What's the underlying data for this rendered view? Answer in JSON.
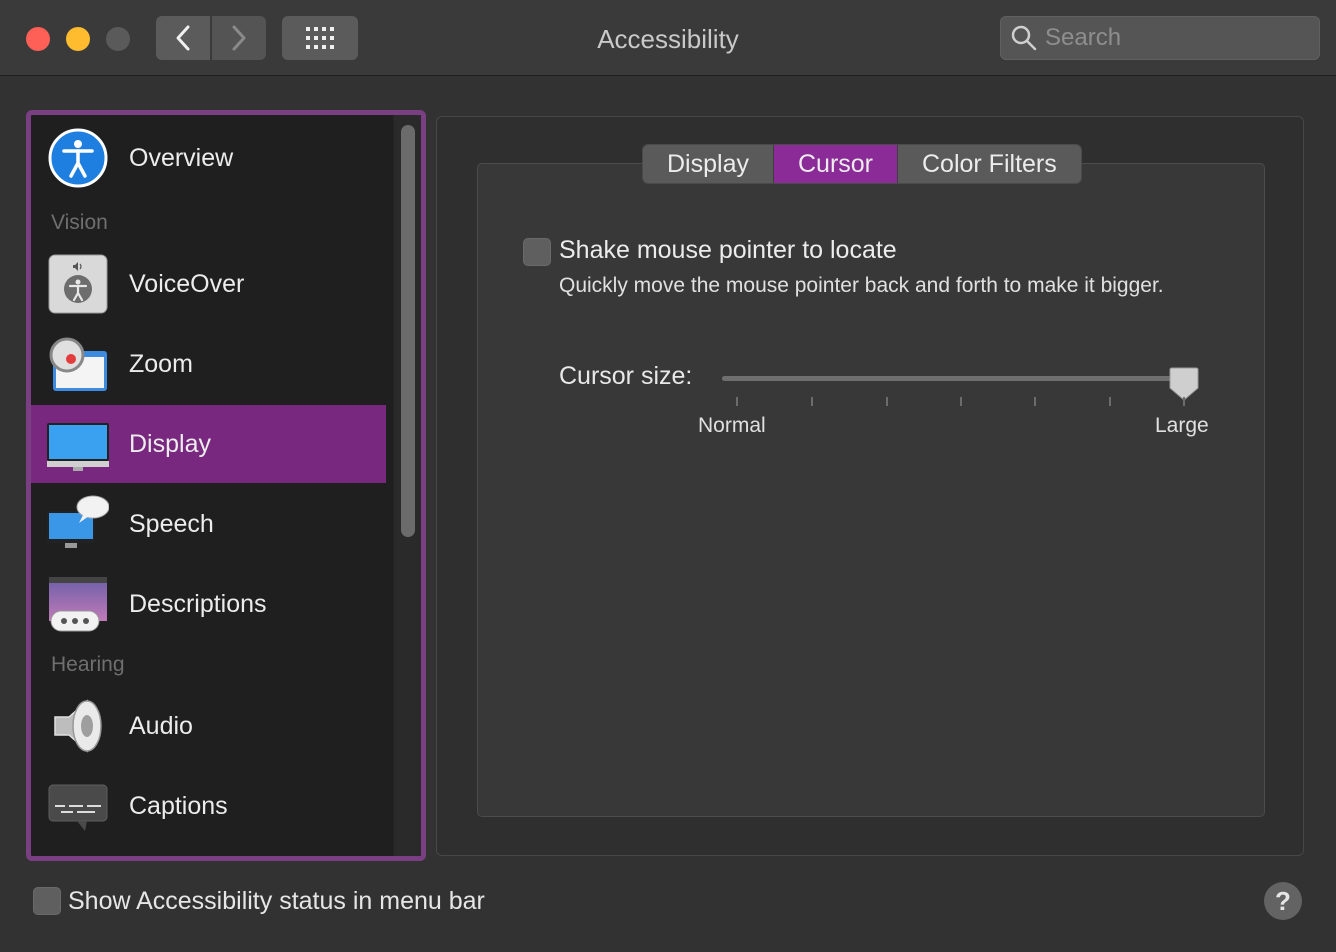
{
  "window": {
    "title": "Accessibility"
  },
  "toolbar": {
    "back_icon": "chevron-left-icon",
    "forward_icon": "chevron-right-icon",
    "grid_icon": "grid-icon"
  },
  "search": {
    "placeholder": "Search",
    "value": ""
  },
  "sidebar": {
    "items": [
      {
        "label": "Overview",
        "icon": "accessibility-overview-icon"
      },
      {
        "label": "VoiceOver",
        "icon": "voiceover-icon"
      },
      {
        "label": "Zoom",
        "icon": "zoom-icon"
      },
      {
        "label": "Display",
        "icon": "display-icon",
        "selected": true
      },
      {
        "label": "Speech",
        "icon": "speech-icon"
      },
      {
        "label": "Descriptions",
        "icon": "descriptions-icon"
      },
      {
        "label": "Audio",
        "icon": "audio-icon"
      },
      {
        "label": "Captions",
        "icon": "captions-icon"
      }
    ],
    "sections": {
      "vision": "Vision",
      "hearing": "Hearing"
    }
  },
  "tabs": [
    {
      "label": "Display"
    },
    {
      "label": "Cursor",
      "active": true
    },
    {
      "label": "Color Filters"
    }
  ],
  "cursor": {
    "shake_label": "Shake mouse pointer to locate",
    "shake_checked": false,
    "shake_description": "Quickly move the mouse pointer back and forth to make it bigger.",
    "size_label": "Cursor size:",
    "size_min_label": "Normal",
    "size_max_label": "Large",
    "size_value_fraction": 1.0
  },
  "footer": {
    "status_label": "Show Accessibility status in menu bar",
    "status_checked": false,
    "help_label": "?"
  },
  "colors": {
    "accent": "#78297f",
    "tab_active": "#8b2b98",
    "sidebar_border": "#7a3f83"
  }
}
